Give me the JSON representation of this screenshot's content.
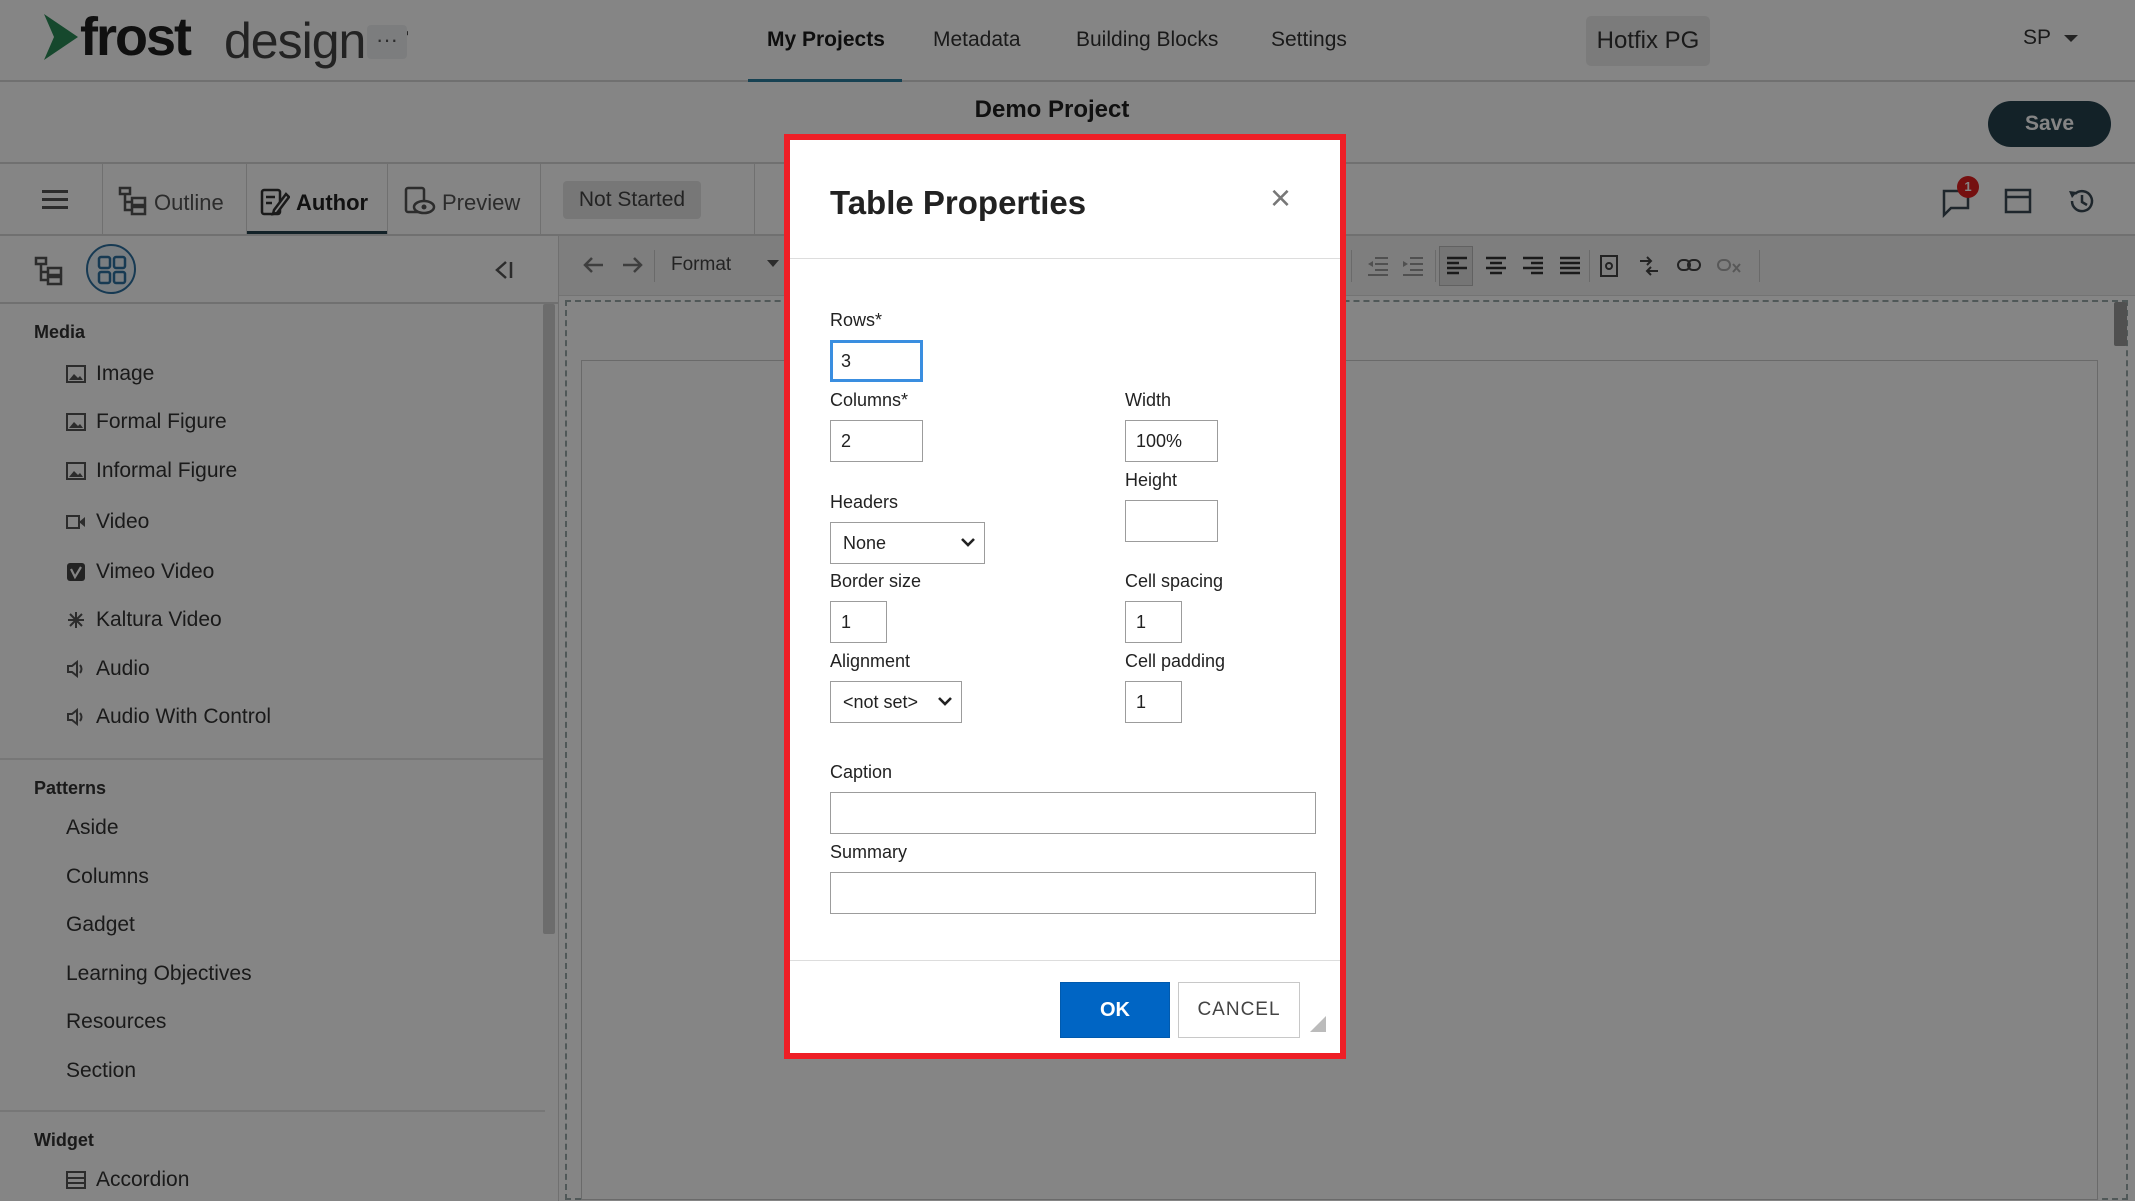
{
  "app": {
    "logo_main": "frost",
    "logo_sub": "designer",
    "more_label": "···",
    "nav": [
      "My Projects",
      "Metadata",
      "Building Blocks",
      "Settings"
    ],
    "workspace": "Hotfix PG",
    "user": "SP",
    "brand_color": "#25424e",
    "accent_color": "#2c7fa0"
  },
  "project": {
    "title": "Demo Project",
    "save_label": "Save"
  },
  "modes": {
    "outline": "Outline",
    "author": "Author",
    "preview": "Preview",
    "status": "Not Started"
  },
  "notifications": {
    "count": "1"
  },
  "panel": {
    "media_label": "Media",
    "media": [
      "Image",
      "Formal Figure",
      "Informal Figure",
      "Video",
      "Vimeo Video",
      "Kaltura Video",
      "Audio",
      "Audio With Control"
    ],
    "patterns_label": "Patterns",
    "patterns": [
      "Aside",
      "Columns",
      "Gadget",
      "Learning Objectives",
      "Resources",
      "Section"
    ],
    "widget_label": "Widget",
    "widgets": [
      "Accordion"
    ]
  },
  "toolbar": {
    "format_label": "Format"
  },
  "dialog": {
    "title": "Table Properties",
    "close_glyph": "×",
    "rows_label": "Rows*",
    "rows_value": "3",
    "columns_label": "Columns*",
    "columns_value": "2",
    "width_label": "Width",
    "width_value": "100%",
    "height_label": "Height",
    "height_value": "",
    "headers_label": "Headers",
    "headers_value": "None",
    "border_label": "Border size",
    "border_value": "1",
    "spacing_label": "Cell spacing",
    "spacing_value": "1",
    "alignment_label": "Alignment",
    "alignment_value": "<not set>",
    "padding_label": "Cell padding",
    "padding_value": "1",
    "caption_label": "Caption",
    "caption_value": "",
    "summary_label": "Summary",
    "summary_value": "",
    "ok_label": "OK",
    "cancel_label": "CANCEL",
    "highlight_color": "#ee1f26",
    "ok_color": "#0065c4"
  }
}
